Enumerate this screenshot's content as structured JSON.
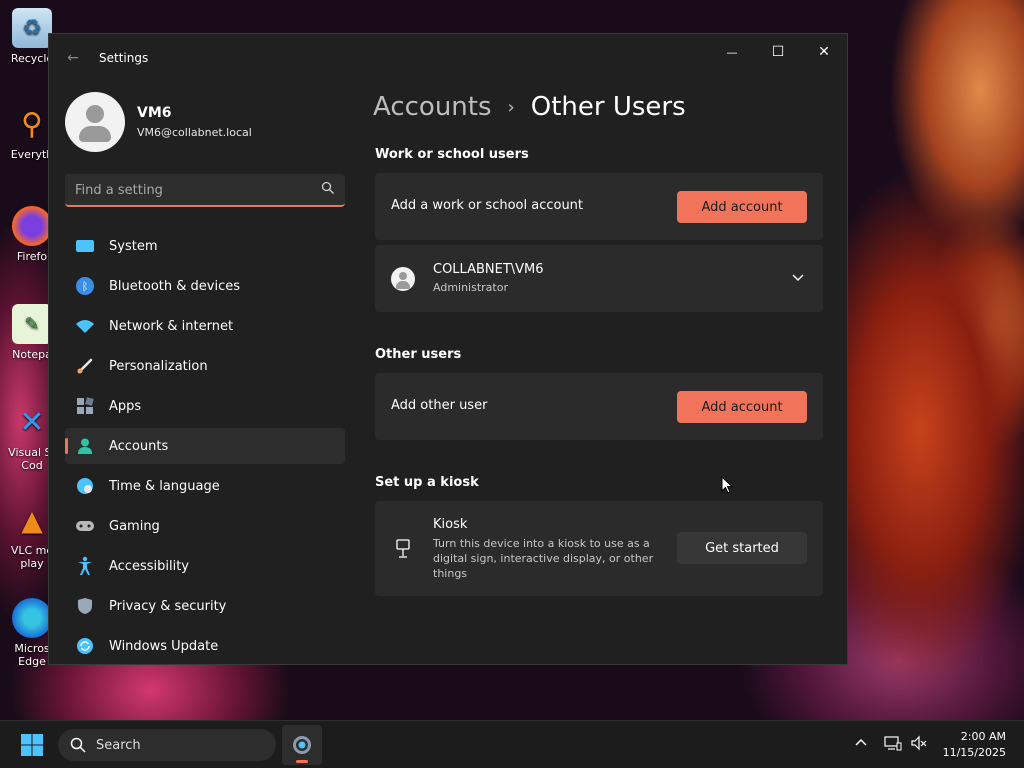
{
  "desktop": {
    "icons": [
      {
        "label": "Recycle",
        "icon": "recycle-bin-icon"
      },
      {
        "label": "Everyth",
        "icon": "everything-search-icon"
      },
      {
        "label": "Firefo",
        "icon": "firefox-icon"
      },
      {
        "label": "Notepa",
        "icon": "notepad-icon"
      },
      {
        "label": "Visual St Cod",
        "icon": "vscode-icon"
      },
      {
        "label": "VLC me play",
        "icon": "vlc-icon"
      },
      {
        "label": "Micros Edge",
        "icon": "edge-icon"
      }
    ]
  },
  "window": {
    "title": "Settings",
    "controls": {
      "minimize": "—",
      "maximize": "☐",
      "close": "✕"
    }
  },
  "profile": {
    "name": "VM6",
    "email": "VM6@collabnet.local"
  },
  "search": {
    "placeholder": "Find a setting"
  },
  "nav": {
    "items": [
      {
        "label": "System",
        "icon": "system-icon",
        "color": "#4cc2ff"
      },
      {
        "label": "Bluetooth & devices",
        "icon": "bluetooth-icon",
        "color": "#3a8ee6"
      },
      {
        "label": "Network & internet",
        "icon": "wifi-icon",
        "color": "#4cc2ff"
      },
      {
        "label": "Personalization",
        "icon": "brush-icon",
        "color": "#f0a060"
      },
      {
        "label": "Apps",
        "icon": "apps-icon",
        "color": "#9aa7b8"
      },
      {
        "label": "Accounts",
        "icon": "accounts-icon",
        "color": "#2ec4a6",
        "active": true
      },
      {
        "label": "Time & language",
        "icon": "globe-icon",
        "color": "#4cc2ff"
      },
      {
        "label": "Gaming",
        "icon": "gamepad-icon",
        "color": "#b8b8b8"
      },
      {
        "label": "Accessibility",
        "icon": "accessibility-icon",
        "color": "#4cc2ff"
      },
      {
        "label": "Privacy & security",
        "icon": "shield-icon",
        "color": "#9aa7b8"
      },
      {
        "label": "Windows Update",
        "icon": "update-icon",
        "color": "#4cc2ff"
      }
    ]
  },
  "content": {
    "breadcrumb": {
      "parent": "Accounts",
      "separator": "›",
      "current": "Other Users"
    },
    "work_section": {
      "title": "Work or school users",
      "add_label": "Add a work or school account",
      "add_button": "Add account",
      "user": {
        "name": "COLLABNET\\VM6",
        "role": "Administrator"
      }
    },
    "other_section": {
      "title": "Other users",
      "add_label": "Add other user",
      "add_button": "Add account"
    },
    "kiosk_section": {
      "title": "Set up a kiosk",
      "name": "Kiosk",
      "description": "Turn this device into a kiosk to use as a digital sign, interactive display, or other things",
      "button": "Get started"
    }
  },
  "taskbar": {
    "search_label": "Search",
    "time": "2:00 AM",
    "date": "11/15/2025"
  },
  "colors": {
    "accent": "#f0735a",
    "window_bg": "#202020",
    "card_bg": "#2b2b2b"
  }
}
